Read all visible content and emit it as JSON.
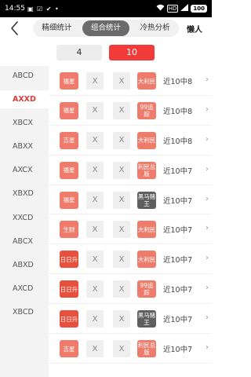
{
  "status": {
    "time": "14:55",
    "left_icons": "▣ ☑ ✔ •",
    "net": "HD",
    "battery": "100"
  },
  "header": {
    "tabs": [
      "精细统计",
      "组合统计",
      "冷热分析"
    ],
    "active_tab": 1,
    "right_label": "懒人"
  },
  "counts": {
    "option_a": "4",
    "option_b": "10",
    "selected": "10"
  },
  "sidebar": {
    "items": [
      "ABCD",
      "AXXD",
      "XBCX",
      "ABXX",
      "AXCX",
      "XBXD",
      "XXCD",
      "ABCX",
      "ABXD",
      "AXCD",
      "XBCD"
    ],
    "active": "AXXD"
  },
  "rows": [
    {
      "tag1": "福星",
      "tag1_color": "#ee7b6b",
      "x2": "X",
      "x3": "X",
      "tag4": "大利民",
      "tag4_color": "#ee7b6b",
      "text": "近10中8"
    },
    {
      "tag1": "福星",
      "tag1_color": "#ee7b6b",
      "x2": "X",
      "x3": "X",
      "tag4": "99追踪",
      "tag4_color": "#ee7b6b",
      "text": "近10中8"
    },
    {
      "tag1": "吉星",
      "tag1_color": "#ee7b6b",
      "x2": "X",
      "x3": "X",
      "tag4": "大利民",
      "tag4_color": "#ee7b6b",
      "text": "近10中8"
    },
    {
      "tag1": "福星",
      "tag1_color": "#ee7b6b",
      "x2": "X",
      "x3": "X",
      "tag4": "利民总版",
      "tag4_color": "#ee7b6b",
      "text": "近10中7"
    },
    {
      "tag1": "福星",
      "tag1_color": "#ee7b6b",
      "x2": "X",
      "x3": "X",
      "tag4": "黑马赌王",
      "tag4_color": "#5f5f5f",
      "text": "近10中7"
    },
    {
      "tag1": "生财",
      "tag1_color": "#ee7b6b",
      "x2": "X",
      "x3": "X",
      "tag4": "大利民",
      "tag4_color": "#ee7b6b",
      "text": "近10中7"
    },
    {
      "tag1": "日日升",
      "tag1_color": "#e8503e",
      "x2": "X",
      "x3": "X",
      "tag4": "大利民",
      "tag4_color": "#ee7b6b",
      "text": "近10中7"
    },
    {
      "tag1": "日日升",
      "tag1_color": "#e8503e",
      "x2": "X",
      "x3": "X",
      "tag4": "99追踪",
      "tag4_color": "#ee7b6b",
      "text": "近10中7"
    },
    {
      "tag1": "日日升",
      "tag1_color": "#e8503e",
      "x2": "X",
      "x3": "X",
      "tag4": "黑马赌王",
      "tag4_color": "#5f5f5f",
      "text": "近10中7"
    },
    {
      "tag1": "吉星",
      "tag1_color": "#ee7b6b",
      "x2": "X",
      "x3": "X",
      "tag4": "利民总版",
      "tag4_color": "#ee7b6b",
      "text": "近10中7"
    }
  ]
}
